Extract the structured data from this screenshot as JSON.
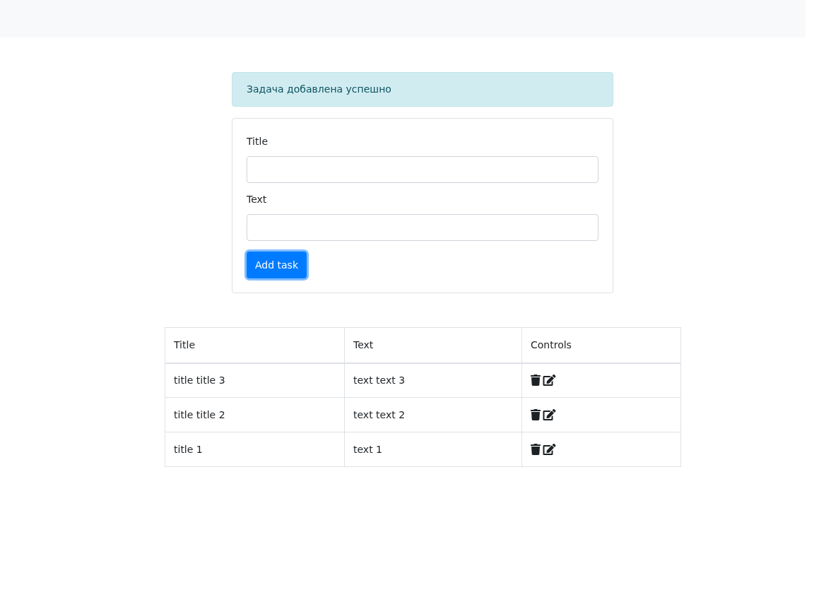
{
  "alert": {
    "text": "Задача добавлена успешно"
  },
  "form": {
    "fields": [
      {
        "label": "Title"
      },
      {
        "label": "Text"
      }
    ],
    "button": {
      "label": "Add task",
      "focused": true
    }
  },
  "table": {
    "columns": [
      "Title",
      "Text",
      "Controls"
    ],
    "rows": [
      {
        "title": "title title 3",
        "text": "text text 3"
      },
      {
        "title": "title title 2",
        "text": "text text 2"
      },
      {
        "title": "title 1",
        "text": "text 1"
      }
    ]
  }
}
